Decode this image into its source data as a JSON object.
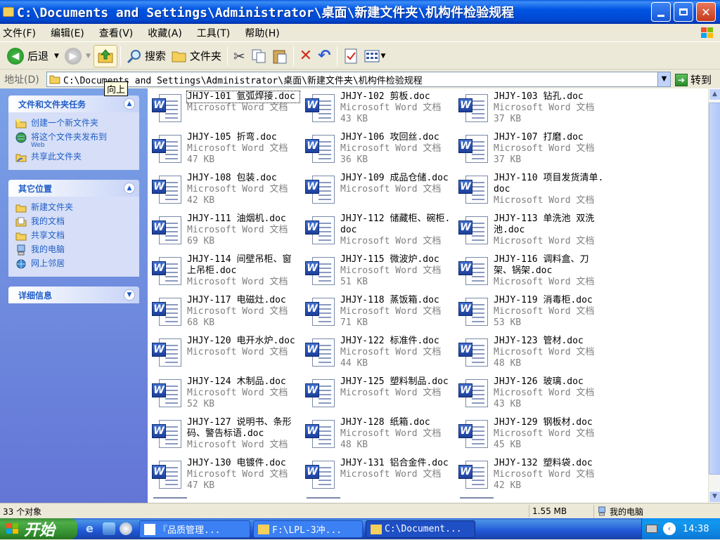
{
  "window": {
    "title": "C:\\Documents and Settings\\Administrator\\桌面\\新建文件夹\\机构件检验规程"
  },
  "menu": [
    "文件(F)",
    "编辑(E)",
    "查看(V)",
    "收藏(A)",
    "工具(T)",
    "帮助(H)"
  ],
  "toolbar": {
    "back": "后退",
    "search": "搜索",
    "folders": "文件夹"
  },
  "address": {
    "label": "地址(D)",
    "path": "C:\\Documents and Settings\\Administrator\\桌面\\新建文件夹\\机构件检验规程",
    "go": "转到",
    "tooltip": "向上"
  },
  "sidebar": {
    "tasks": {
      "title": "文件和文件夹任务",
      "items": [
        {
          "label": "创建一个新文件夹",
          "icon": "new-folder-icon"
        },
        {
          "label": "将这个文件夹发布到",
          "sub": "Web",
          "icon": "publish-web-icon"
        },
        {
          "label": "共享此文件夹",
          "icon": "share-folder-icon"
        }
      ]
    },
    "places": {
      "title": "其它位置",
      "items": [
        {
          "label": "新建文件夹",
          "icon": "folder-icon"
        },
        {
          "label": "我的文档",
          "icon": "my-documents-icon"
        },
        {
          "label": "共享文档",
          "icon": "shared-documents-icon"
        },
        {
          "label": "我的电脑",
          "icon": "my-computer-icon"
        },
        {
          "label": "网上邻居",
          "icon": "network-icon"
        }
      ]
    },
    "details": {
      "title": "详细信息"
    }
  },
  "files": [
    {
      "name": "JHJY-101 氩弧焊接.doc",
      "type": "Microsoft Word 文档",
      "size": ""
    },
    {
      "name": "JHJY-102 剪板.doc",
      "type": "Microsoft Word 文档",
      "size": "43 KB"
    },
    {
      "name": "JHJY-103 钻孔.doc",
      "type": "Microsoft Word 文档",
      "size": "37 KB"
    },
    {
      "name": "JHJY-105 折弯.doc",
      "type": "Microsoft Word 文档",
      "size": "47 KB"
    },
    {
      "name": "JHJY-106 攻回丝.doc",
      "type": "Microsoft Word 文档",
      "size": "36 KB"
    },
    {
      "name": "JHJY-107 打磨.doc",
      "type": "Microsoft Word 文档",
      "size": "37 KB"
    },
    {
      "name": "JHJY-108 包装.doc",
      "type": "Microsoft Word 文档",
      "size": "42 KB"
    },
    {
      "name": "JHJY-109 成品仓储.doc",
      "type": "Microsoft Word 文档",
      "size": ""
    },
    {
      "name": "JHJY-110 项目发货清单.doc",
      "type": "Microsoft Word 文档",
      "size": ""
    },
    {
      "name": "JHJY-111 油烟机.doc",
      "type": "Microsoft Word 文档",
      "size": "69 KB"
    },
    {
      "name": "JHJY-112 储藏柜、碗柜.doc",
      "type": "Microsoft Word 文档",
      "size": ""
    },
    {
      "name": "JHJY-113 单洗池 双洗池.doc",
      "type": "Microsoft Word 文档",
      "size": ""
    },
    {
      "name": "JHJY-114 间壁吊柜、窗上吊柜.doc",
      "type": "Microsoft Word 文档",
      "size": ""
    },
    {
      "name": "JHJY-115 微波炉.doc",
      "type": "Microsoft Word 文档",
      "size": "51 KB"
    },
    {
      "name": "JHJY-116 调料盒、刀架、锅架.doc",
      "type": "Microsoft Word 文档",
      "size": ""
    },
    {
      "name": "JHJY-117 电磁灶.doc",
      "type": "Microsoft Word 文档",
      "size": "68 KB"
    },
    {
      "name": "JHJY-118 蒸饭箱.doc",
      "type": "Microsoft Word 文档",
      "size": "71 KB"
    },
    {
      "name": "JHJY-119 消毒柜.doc",
      "type": "Microsoft Word 文档",
      "size": "53 KB"
    },
    {
      "name": "JHJY-120 电开水炉.doc",
      "type": "Microsoft Word 文档",
      "size": ""
    },
    {
      "name": "JHJY-122 标准件.doc",
      "type": "Microsoft Word 文档",
      "size": "44 KB"
    },
    {
      "name": "JHJY-123 管材.doc",
      "type": "Microsoft Word 文档",
      "size": "48 KB"
    },
    {
      "name": "JHJY-124 木制品.doc",
      "type": "Microsoft Word 文档",
      "size": "52 KB"
    },
    {
      "name": "JHJY-125 塑料制品.doc",
      "type": "Microsoft Word 文档",
      "size": ""
    },
    {
      "name": "JHJY-126 玻璃.doc",
      "type": "Microsoft Word 文档",
      "size": "43 KB"
    },
    {
      "name": "JHJY-127 说明书、条形码、警告标语.doc",
      "type": "Microsoft Word 文档",
      "size": ""
    },
    {
      "name": "JHJY-128 纸箱.doc",
      "type": "Microsoft Word 文档",
      "size": "48 KB"
    },
    {
      "name": "JHJY-129 钢板材.doc",
      "type": "Microsoft Word 文档",
      "size": "45 KB"
    },
    {
      "name": "JHJY-130 电镀件.doc",
      "type": "Microsoft Word 文档",
      "size": "47 KB"
    },
    {
      "name": "JHJY-131 铝合金件.doc",
      "type": "Microsoft Word 文档",
      "size": ""
    },
    {
      "name": "JHJY-132 塑料袋.doc",
      "type": "Microsoft Word 文档",
      "size": "42 KB"
    }
  ],
  "status": {
    "count": "33 个对象",
    "size": "1.55 MB",
    "location": "我的电脑"
  },
  "taskbar": {
    "start": "开始",
    "buttons": [
      "『品质管理...",
      "F:\\LPL-3冲...",
      "C:\\Document..."
    ],
    "clock": "14:38"
  }
}
